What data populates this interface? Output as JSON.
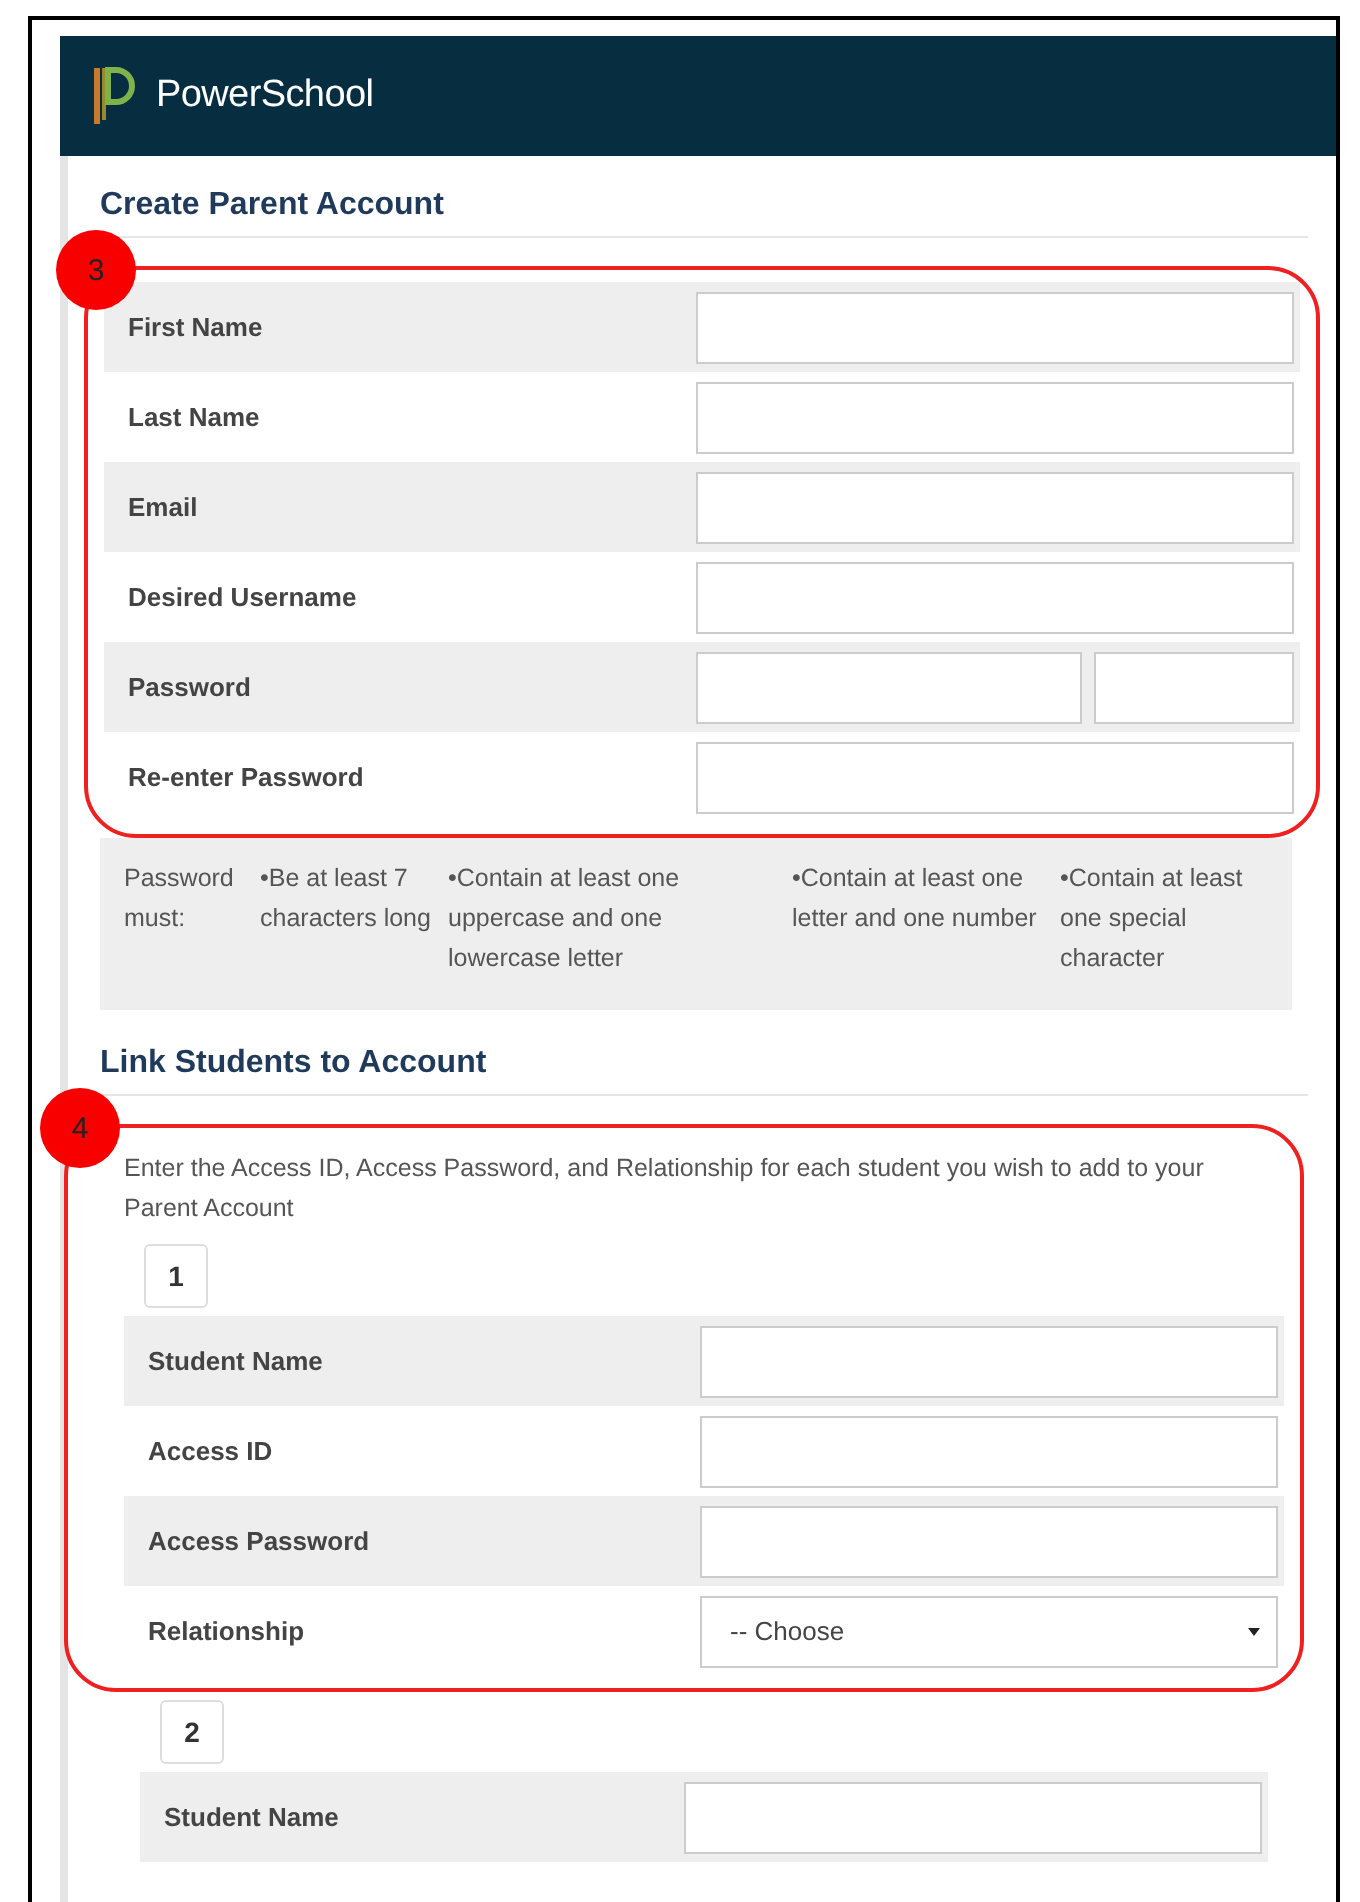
{
  "header": {
    "brand": "PowerSchool"
  },
  "parent_section": {
    "title": "Create Parent Account",
    "badge": "3",
    "fields": [
      {
        "label": "First Name",
        "kind": "text"
      },
      {
        "label": "Last Name",
        "kind": "text"
      },
      {
        "label": "Email",
        "kind": "text"
      },
      {
        "label": "Desired Username",
        "kind": "text"
      },
      {
        "label": "Password",
        "kind": "password_pair"
      },
      {
        "label": "Re-enter Password",
        "kind": "text"
      }
    ]
  },
  "password_rules": {
    "label": "Password must:",
    "rules": [
      "•Be at least 7 characters long",
      "•Contain at least one uppercase and one lowercase letter",
      "•Contain at least one letter and one number",
      "•Contain at least one special character"
    ]
  },
  "students_section": {
    "title": "Link Students to Account",
    "badge": "4",
    "intro": "Enter the Access ID, Access Password, and Relationship for each student you wish to add to your Parent Account",
    "students": [
      {
        "number": "1",
        "highlighted": true,
        "fields": [
          {
            "label": "Student Name",
            "kind": "text"
          },
          {
            "label": "Access ID",
            "kind": "text"
          },
          {
            "label": "Access Password",
            "kind": "text"
          },
          {
            "label": "Relationship",
            "kind": "select",
            "value": "-- Choose"
          }
        ]
      },
      {
        "number": "2",
        "highlighted": false,
        "fields": [
          {
            "label": "Student Name",
            "kind": "text"
          }
        ]
      }
    ]
  }
}
